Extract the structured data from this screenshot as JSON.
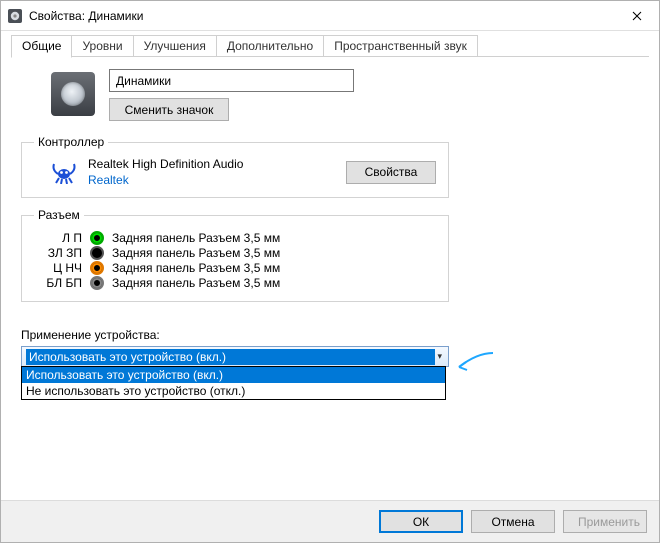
{
  "window": {
    "title": "Свойства: Динамики"
  },
  "tabs": [
    {
      "label": "Общие"
    },
    {
      "label": "Уровни"
    },
    {
      "label": "Улучшения"
    },
    {
      "label": "Дополнительно"
    },
    {
      "label": "Пространственный звук"
    }
  ],
  "general": {
    "device_name": "Динамики",
    "change_icon_btn": "Сменить значок"
  },
  "controller": {
    "legend": "Контроллер",
    "name": "Realtek High Definition Audio",
    "vendor": "Realtek",
    "props_btn": "Свойства"
  },
  "jacks": {
    "legend": "Разъем",
    "items": [
      {
        "label": "Л П",
        "color": "green",
        "desc": "Задняя панель Разъем 3,5 мм"
      },
      {
        "label": "ЗЛ ЗП",
        "color": "black",
        "desc": "Задняя панель Разъем 3,5 мм"
      },
      {
        "label": "Ц НЧ",
        "color": "orange",
        "desc": "Задняя панель Разъем 3,5 мм"
      },
      {
        "label": "БЛ БП",
        "color": "gray",
        "desc": "Задняя панель Разъем 3,5 мм"
      }
    ]
  },
  "usage": {
    "label": "Применение устройства:",
    "selected": "Использовать это устройство (вкл.)",
    "options": [
      "Использовать это устройство (вкл.)",
      "Не использовать это устройство (откл.)"
    ]
  },
  "buttons": {
    "ok": "ОК",
    "cancel": "Отмена",
    "apply": "Применить"
  }
}
